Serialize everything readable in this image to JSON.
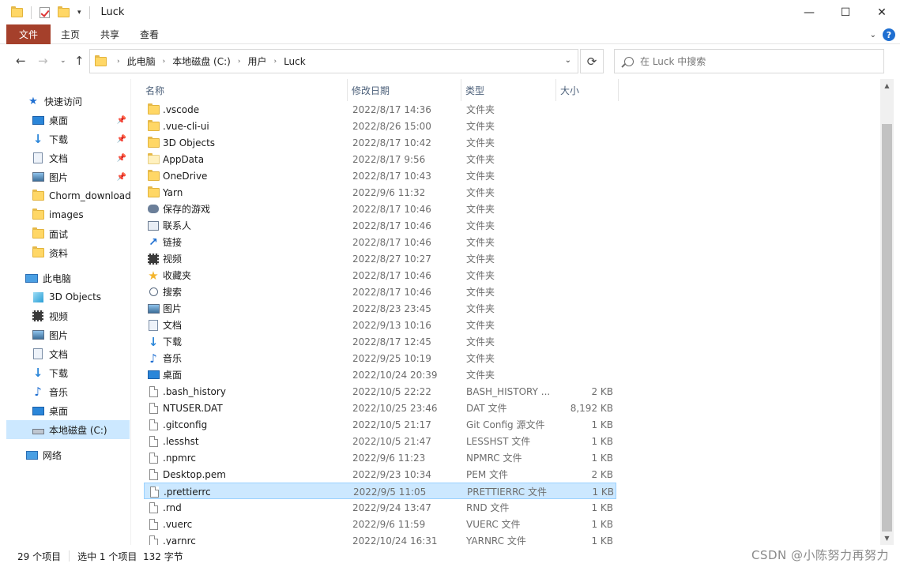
{
  "window": {
    "title": "Luck",
    "minimize_glyph": "—",
    "maximize_glyph": "☐",
    "close_glyph": "✕"
  },
  "ribbon": {
    "tabs": [
      "文件",
      "主页",
      "共享",
      "查看"
    ],
    "help_glyph": "?"
  },
  "address": {
    "crumbs": [
      "此电脑",
      "本地磁盘 (C:)",
      "用户",
      "Luck"
    ]
  },
  "search": {
    "placeholder": "在 Luck 中搜索"
  },
  "nav": {
    "items": [
      {
        "label": "快速访问",
        "icon": "star-icon",
        "pinned": false
      },
      {
        "label": "桌面",
        "icon": "desktop-icon",
        "pinned": true
      },
      {
        "label": "下载",
        "icon": "download-icon",
        "pinned": true
      },
      {
        "label": "文档",
        "icon": "document-icon",
        "pinned": true
      },
      {
        "label": "图片",
        "icon": "pictures-icon",
        "pinned": true
      },
      {
        "label": "Chorm_download",
        "icon": "folder-icon",
        "pinned": false
      },
      {
        "label": "images",
        "icon": "folder-icon",
        "pinned": false
      },
      {
        "label": "面试",
        "icon": "folder-icon",
        "pinned": false
      },
      {
        "label": "资料",
        "icon": "folder-icon",
        "pinned": false
      },
      {
        "label": "此电脑",
        "icon": "computer-icon",
        "pinned": false
      },
      {
        "label": "3D Objects",
        "icon": "cube-icon",
        "pinned": false
      },
      {
        "label": "视频",
        "icon": "video-icon",
        "pinned": false
      },
      {
        "label": "图片",
        "icon": "pictures-icon",
        "pinned": false
      },
      {
        "label": "文档",
        "icon": "document-icon",
        "pinned": false
      },
      {
        "label": "下载",
        "icon": "download-icon",
        "pinned": false
      },
      {
        "label": "音乐",
        "icon": "music-icon",
        "pinned": false
      },
      {
        "label": "桌面",
        "icon": "desktop-icon",
        "pinned": false
      },
      {
        "label": "本地磁盘 (C:)",
        "icon": "drive-icon",
        "pinned": false
      },
      {
        "label": "网络",
        "icon": "network-icon",
        "pinned": false
      }
    ]
  },
  "columns": {
    "name": "名称",
    "date": "修改日期",
    "type": "类型",
    "size": "大小"
  },
  "files": [
    {
      "name": ".vscode",
      "date": "2022/8/17 14:36",
      "type": "文件夹",
      "size": "",
      "icon": "folder-icon"
    },
    {
      "name": ".vue-cli-ui",
      "date": "2022/8/26 15:00",
      "type": "文件夹",
      "size": "",
      "icon": "folder-icon"
    },
    {
      "name": "3D Objects",
      "date": "2022/8/17 10:42",
      "type": "文件夹",
      "size": "",
      "icon": "folder-icon"
    },
    {
      "name": "AppData",
      "date": "2022/8/17 9:56",
      "type": "文件夹",
      "size": "",
      "icon": "folder-light-icon"
    },
    {
      "name": "OneDrive",
      "date": "2022/8/17 10:43",
      "type": "文件夹",
      "size": "",
      "icon": "folder-icon"
    },
    {
      "name": "Yarn",
      "date": "2022/9/6 11:32",
      "type": "文件夹",
      "size": "",
      "icon": "folder-icon"
    },
    {
      "name": "保存的游戏",
      "date": "2022/8/17 10:46",
      "type": "文件夹",
      "size": "",
      "icon": "saved-games-icon"
    },
    {
      "name": "联系人",
      "date": "2022/8/17 10:46",
      "type": "文件夹",
      "size": "",
      "icon": "contacts-icon"
    },
    {
      "name": "链接",
      "date": "2022/8/17 10:46",
      "type": "文件夹",
      "size": "",
      "icon": "links-icon"
    },
    {
      "name": "视频",
      "date": "2022/8/27 10:27",
      "type": "文件夹",
      "size": "",
      "icon": "video-icon"
    },
    {
      "name": "收藏夹",
      "date": "2022/8/17 10:46",
      "type": "文件夹",
      "size": "",
      "icon": "favorites-icon"
    },
    {
      "name": "搜索",
      "date": "2022/8/17 10:46",
      "type": "文件夹",
      "size": "",
      "icon": "search-icon"
    },
    {
      "name": "图片",
      "date": "2022/8/23 23:45",
      "type": "文件夹",
      "size": "",
      "icon": "pictures-icon"
    },
    {
      "name": "文档",
      "date": "2022/9/13 10:16",
      "type": "文件夹",
      "size": "",
      "icon": "document-icon"
    },
    {
      "name": "下载",
      "date": "2022/8/17 12:45",
      "type": "文件夹",
      "size": "",
      "icon": "download-icon"
    },
    {
      "name": "音乐",
      "date": "2022/9/25 10:19",
      "type": "文件夹",
      "size": "",
      "icon": "music-icon"
    },
    {
      "name": "桌面",
      "date": "2022/10/24 20:39",
      "type": "文件夹",
      "size": "",
      "icon": "desktop-icon"
    },
    {
      "name": ".bash_history",
      "date": "2022/10/5 22:22",
      "type": "BASH_HISTORY ...",
      "size": "2 KB",
      "icon": "file-icon"
    },
    {
      "name": "NTUSER.DAT",
      "date": "2022/10/25 23:46",
      "type": "DAT 文件",
      "size": "8,192 KB",
      "icon": "file-icon"
    },
    {
      "name": ".gitconfig",
      "date": "2022/10/5 21:17",
      "type": "Git Config 源文件",
      "size": "1 KB",
      "icon": "config-file-icon"
    },
    {
      "name": ".lesshst",
      "date": "2022/10/5 21:47",
      "type": "LESSHST 文件",
      "size": "1 KB",
      "icon": "file-icon"
    },
    {
      "name": ".npmrc",
      "date": "2022/9/6 11:23",
      "type": "NPMRC 文件",
      "size": "1 KB",
      "icon": "file-icon"
    },
    {
      "name": "Desktop.pem",
      "date": "2022/9/23 10:34",
      "type": "PEM 文件",
      "size": "2 KB",
      "icon": "file-icon"
    },
    {
      "name": ".prettierrc",
      "date": "2022/9/5 11:05",
      "type": "PRETTIERRC 文件",
      "size": "1 KB",
      "icon": "file-icon",
      "selected": true
    },
    {
      "name": ".rnd",
      "date": "2022/9/24 13:47",
      "type": "RND 文件",
      "size": "1 KB",
      "icon": "file-icon"
    },
    {
      "name": ".vuerc",
      "date": "2022/9/6 11:59",
      "type": "VUERC 文件",
      "size": "1 KB",
      "icon": "file-icon"
    },
    {
      "name": ".yarnrc",
      "date": "2022/10/24 16:31",
      "type": "YARNRC 文件",
      "size": "1 KB",
      "icon": "file-icon"
    }
  ],
  "status": {
    "count": "29 个项目",
    "selection": "选中 1 个项目  132 字节"
  },
  "watermark": "CSDN @小陈努力再努力",
  "colors": {
    "file_tab": "#a5402b",
    "selection": "#cce8ff",
    "folder": "#ffd766",
    "accent": "#1f6fd1"
  }
}
